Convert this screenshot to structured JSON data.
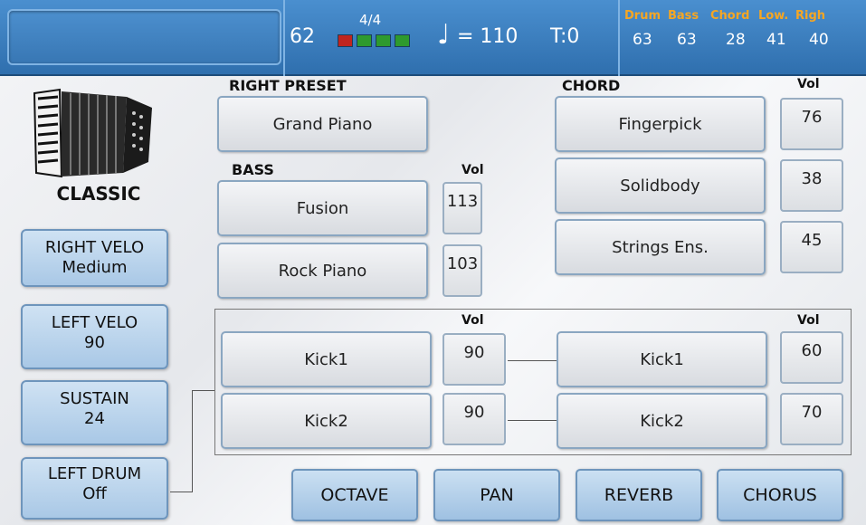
{
  "top": {
    "tempo_number": "62",
    "time_signature": "4/4",
    "beat_colors": [
      "#c0251e",
      "#2e9a2e",
      "#2e9a2e",
      "#2e9a2e"
    ],
    "tempo_text": "= 110",
    "transpose": "T:0",
    "mixer": [
      {
        "label": "Drum",
        "value": "63"
      },
      {
        "label": "Bass",
        "value": "63"
      },
      {
        "label": "Chord",
        "value": "28"
      },
      {
        "label": "Low.",
        "value": "41"
      },
      {
        "label": "Righ",
        "value": "40"
      }
    ]
  },
  "left": {
    "style_name": "CLASSIC",
    "right_velo": {
      "title": "RIGHT VELO",
      "value": "Medium"
    },
    "left_velo": {
      "title": "LEFT VELO",
      "value": "90"
    },
    "sustain": {
      "title": "SUSTAIN",
      "value": "24"
    },
    "left_drum": {
      "title": "LEFT DRUM",
      "value": "Off"
    }
  },
  "right_preset": {
    "label": "RIGHT PRESET",
    "value": "Grand Piano"
  },
  "bass": {
    "label": "BASS",
    "vol_label": "Vol",
    "items": [
      {
        "name": "Fusion",
        "vol": "113"
      },
      {
        "name": "Rock Piano",
        "vol": "103"
      }
    ]
  },
  "chord": {
    "label": "CHORD",
    "vol_label": "Vol",
    "items": [
      {
        "name": "Fingerpick",
        "vol": "76"
      },
      {
        "name": "Solidbody",
        "vol": "38"
      },
      {
        "name": "Strings Ens.",
        "vol": "45"
      }
    ]
  },
  "drums": {
    "vol_label": "Vol",
    "left": [
      {
        "name": "Kick1",
        "vol": "90"
      },
      {
        "name": "Kick2",
        "vol": "90"
      }
    ],
    "right": [
      {
        "name": "Kick1",
        "vol": "60"
      },
      {
        "name": "Kick2",
        "vol": "70"
      }
    ]
  },
  "bottom_buttons": [
    "OCTAVE",
    "PAN",
    "REVERB",
    "CHORUS"
  ],
  "colors": {
    "header": "#2f6fae",
    "mixer_label": "#f5a623",
    "button_blue": "#a9c8e6"
  }
}
